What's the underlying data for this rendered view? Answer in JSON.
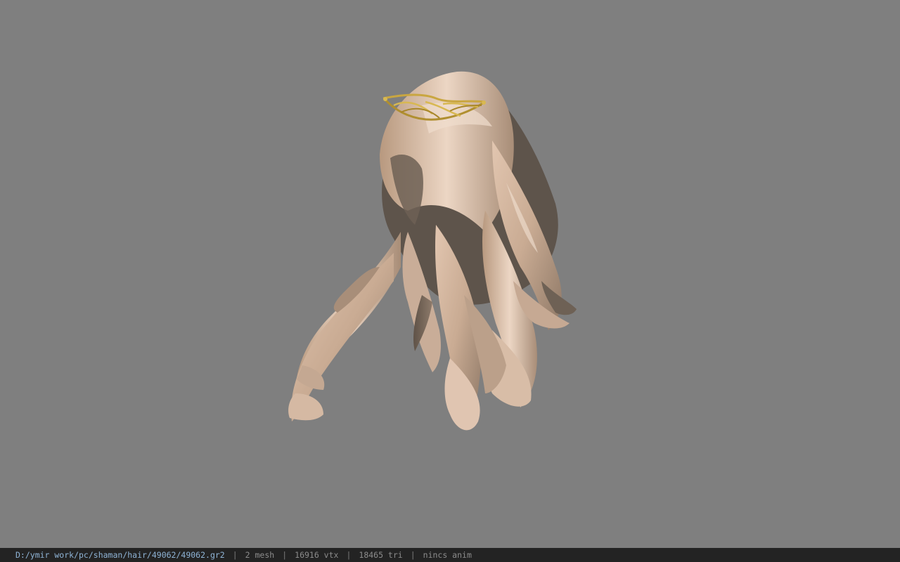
{
  "viewer": {
    "background_color": "#7f7f7f",
    "model_subject": "long wavy blonde hair with gold tiara"
  },
  "statusbar": {
    "file_path": "D:/ymir work/pc/shaman/hair/49062/49062.gr2",
    "mesh_count": "2 mesh",
    "vertex_count": "16916 vtx",
    "triangle_count": "18465 tri",
    "animation_status": "nincs anim",
    "separator": "|",
    "path_color": "#8fb4d6",
    "text_color": "#8c8c8c",
    "background_color": "#232323"
  }
}
